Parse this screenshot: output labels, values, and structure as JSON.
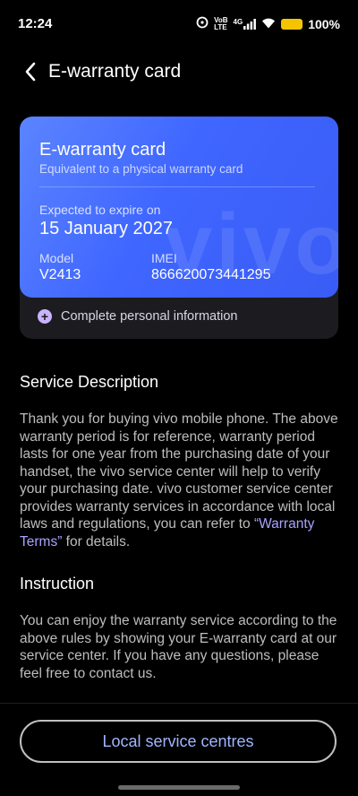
{
  "status_bar": {
    "time": "12:24",
    "network_small_top": "VoB",
    "network_small_bottom": "LTE",
    "network_type": "4G",
    "battery_percent": "100%"
  },
  "header": {
    "title": "E-warranty card"
  },
  "card": {
    "title": "E-warranty card",
    "subtitle": "Equivalent to a physical warranty card",
    "watermark": "vivo",
    "expire_label": "Expected to expire on",
    "expire_date": "15 January 2027",
    "model_label": "Model",
    "model_value": "V2413",
    "imei_label": "IMEI",
    "imei_value": "866620073441295"
  },
  "complete_info": {
    "icon": "plus-circle-icon",
    "label": "Complete personal information"
  },
  "service_description": {
    "title": "Service Description",
    "body_prefix": "Thank you for buying vivo mobile phone. The above warranty period is for reference, warranty period lasts for one year from the purchasing date of your handset, the vivo service center will help to verify your purchasing date. vivo customer service center provides warranty services in accordance with local laws and regulations, you can refer to ",
    "link_text": "“Warranty Terms”",
    "body_suffix": " for details."
  },
  "instruction": {
    "title": "Instruction",
    "body": "You can enjoy the warranty service according to the above rules by showing your E-warranty card at our service center. If you have any questions, please feel free to contact us."
  },
  "actions": {
    "local_service_centres": "Local service centres"
  },
  "colors": {
    "card_accent": "#4369ff",
    "link": "#a9a3ff",
    "button_text": "#9fb6ff",
    "battery": "#f5c400"
  }
}
